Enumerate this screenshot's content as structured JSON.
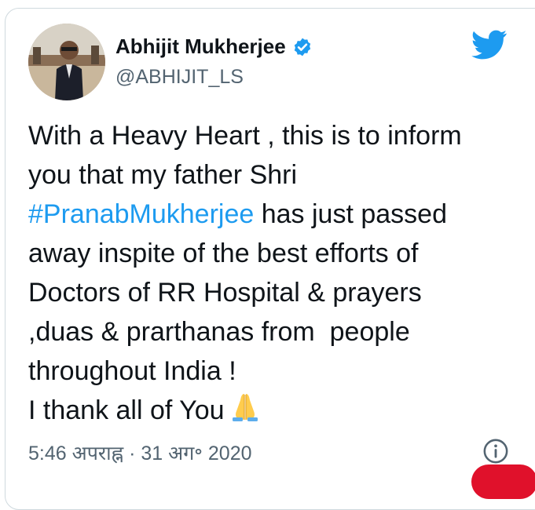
{
  "tweet": {
    "display_name": "Abhijit Mukherjee",
    "handle": "@ABHIJIT_LS",
    "verified": true,
    "lines": [
      {
        "text": "With a Heavy Heart , this is to inform"
      },
      {
        "text": "you that my father Shri"
      },
      {
        "hashtag": "#PranabMukherjee",
        "text": " has just passed"
      },
      {
        "text": "away inspite of the best efforts of"
      },
      {
        "text": "Doctors of RR Hospital & prayers"
      },
      {
        "text": ",duas & prarthanas from  people"
      },
      {
        "text": "throughout India !"
      },
      {
        "text": "I thank all of You"
      }
    ],
    "emoji": "folded-hands",
    "timestamp": "5:46 अपराह्न · 31 अग॰ 2020"
  },
  "icons": {
    "platform": "twitter-bird-icon",
    "verified": "verified-badge-icon",
    "info": "info-icon"
  },
  "colors": {
    "accent": "#1d9bf0",
    "text": "#0f1419",
    "muted": "#536471",
    "border": "#cfd9de"
  }
}
